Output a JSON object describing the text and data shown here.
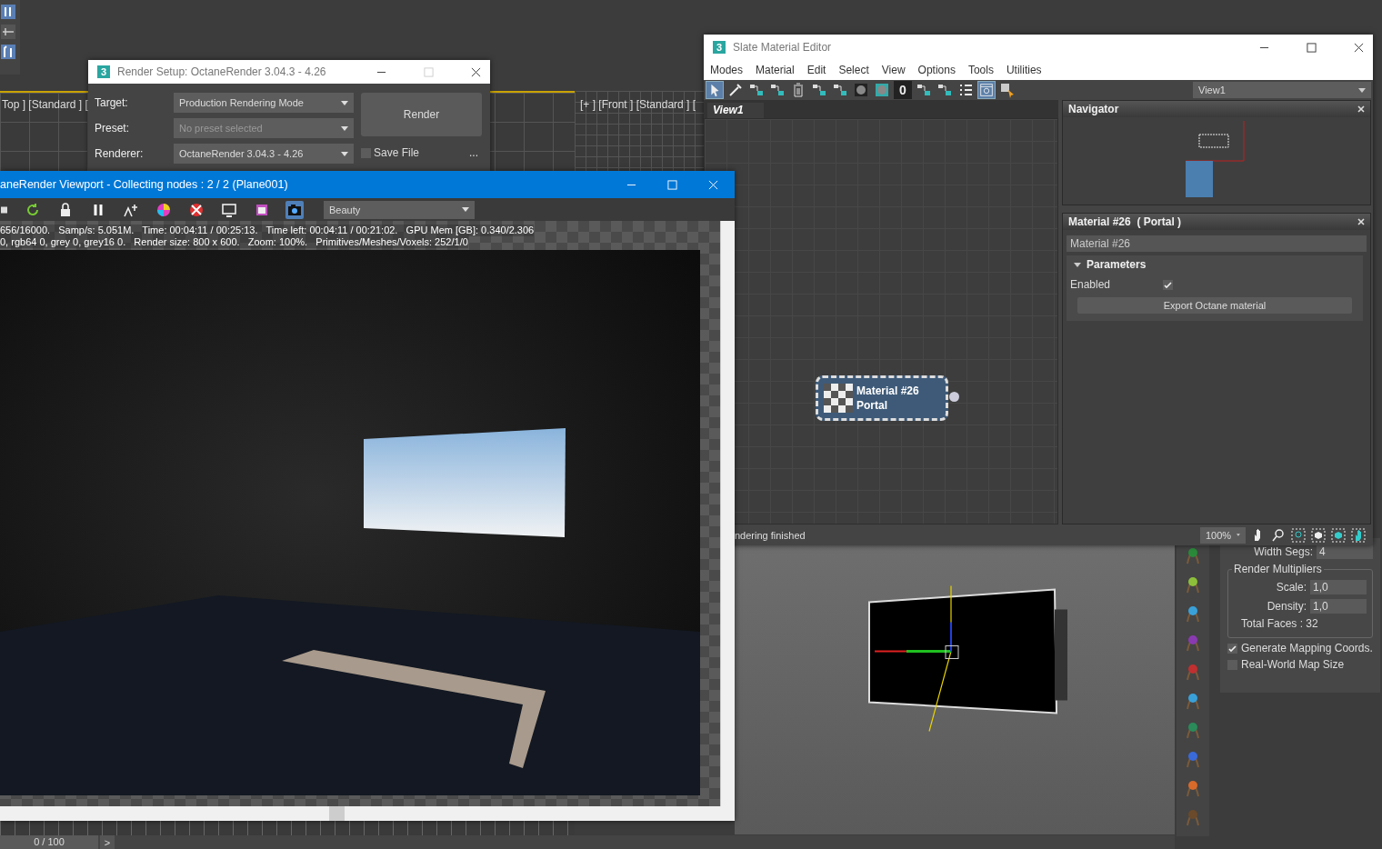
{
  "viewports": [
    {
      "label": "Top ] [Standard ] ["
    },
    {
      "label": "[+ ] [Front ] [Standard ] ["
    }
  ],
  "render_setup": {
    "title": "Render Setup: OctaneRender 3.04.3 - 4.26",
    "fields": [
      {
        "label": "Target:",
        "value": "Production Rendering Mode",
        "disabled": false
      },
      {
        "label": "Preset:",
        "value": "No preset selected",
        "disabled": true
      },
      {
        "label": "Renderer:",
        "value": "OctaneRender 3.04.3 - 4.26",
        "disabled": false
      }
    ],
    "render_button": "Render",
    "save_file": {
      "label": "Save File",
      "checked": false
    },
    "more": "..."
  },
  "octane_viewport": {
    "title": "aneRender Viewport - Collecting nodes : 2 / 2 (Plane001)",
    "toolbar": [
      {
        "kind": "save",
        "selected": false
      },
      {
        "kind": "refresh",
        "selected": false
      },
      {
        "kind": "lock",
        "selected": false
      },
      {
        "kind": "pause",
        "selected": false
      },
      {
        "kind": "focus",
        "selected": false
      },
      {
        "kind": "color",
        "selected": false
      },
      {
        "kind": "nocolor",
        "selected": false
      },
      {
        "kind": "monitor",
        "selected": false
      },
      {
        "kind": "region",
        "selected": false
      },
      {
        "kind": "camera",
        "selected": true
      }
    ],
    "pass": "Beauty",
    "stats": [
      "656/16000.   Samp/s: 5.051M.   Time: 00:04:11 / 00:25:13.   Time left: 00:04:11 / 00:21:02.   GPU Mem [GB]: 0.340/2.306",
      "0, rgb64 0, grey 0, grey16 0.   Render size: 800 x 600.   Zoom: 100%.   Primitives/Meshes/Voxels: 252/1/0"
    ]
  },
  "slate_editor": {
    "title": "Slate Material Editor",
    "menus": [
      "Modes",
      "Material",
      "Edit",
      "Select",
      "View",
      "Options",
      "Tools",
      "Utilities"
    ],
    "toolbar": [
      {
        "kind": "select",
        "selected": true
      },
      {
        "kind": "picker",
        "selected": false
      },
      {
        "kind": "assign",
        "selected": false
      },
      {
        "kind": "put",
        "selected": false
      },
      {
        "kind": "delete",
        "selected": false
      },
      {
        "kind": "layout",
        "selected": false
      },
      {
        "kind": "child",
        "selected": false
      },
      {
        "kind": "background",
        "selected": false
      },
      {
        "kind": "checker",
        "selected": false
      },
      {
        "kind": "number",
        "label": "0",
        "selected": false
      },
      {
        "kind": "branch",
        "selected": false
      },
      {
        "kind": "fork",
        "selected": false
      },
      {
        "kind": "list",
        "selected": false
      },
      {
        "kind": "options",
        "selected": true
      },
      {
        "kind": "pick",
        "selected": false
      }
    ],
    "view_dropdown": "View1",
    "view_tab": "View1",
    "node": {
      "name": "Material #26",
      "type": "Portal"
    },
    "navigator": {
      "title": "Navigator"
    },
    "material_panel": {
      "title": "Material #26  ( Portal )",
      "name": "Material #26",
      "rollout": {
        "title": "Parameters",
        "expanded": true
      },
      "enabled": {
        "label": "Enabled",
        "checked": true
      },
      "export_button": "Export Octane material"
    },
    "status": "ndering finished",
    "zoom": "100%"
  },
  "command_panel": {
    "width_segs": {
      "label": "Width Segs:",
      "value": "4"
    },
    "group": "Render Multipliers",
    "spinners": [
      {
        "label": "Scale:",
        "value": "1,0"
      },
      {
        "label": "Density:",
        "value": "1,0"
      }
    ],
    "total_faces": "Total Faces : 32",
    "checkboxes": [
      {
        "label": "Generate Mapping Coords.",
        "checked": true
      },
      {
        "label": "Real-World Map Size",
        "checked": false
      }
    ]
  },
  "timeline": {
    "frame": "0 / 100",
    "next": ">"
  },
  "app_icons": [
    "3",
    "3"
  ]
}
